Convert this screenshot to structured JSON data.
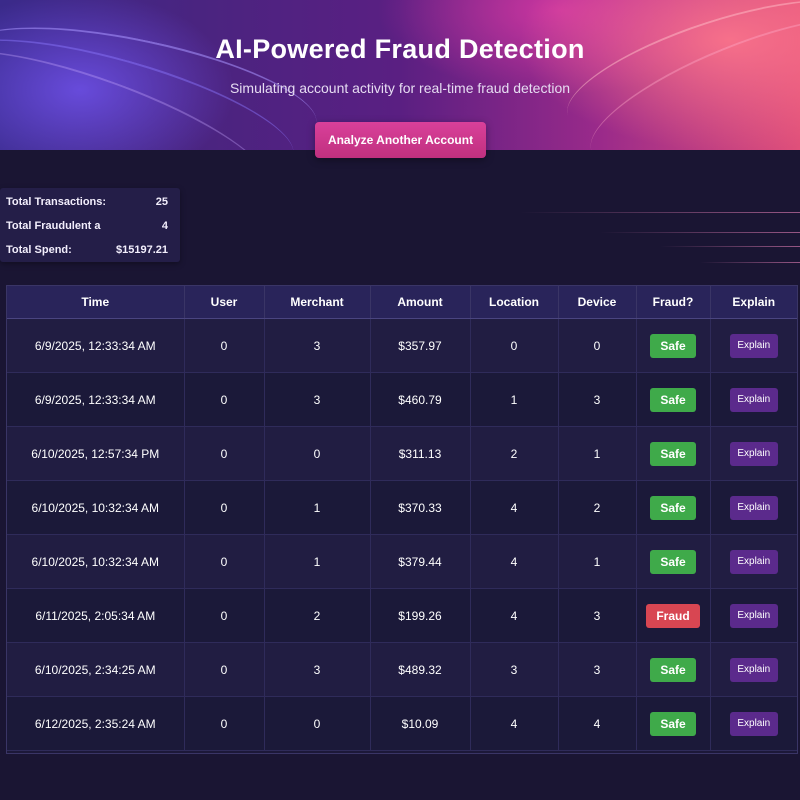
{
  "header": {
    "title": "AI-Powered Fraud Detection",
    "subtitle": "Simulating account activity for real-time fraud detection",
    "analyze_button_label": "Analyze Another Account"
  },
  "summary": {
    "items": [
      {
        "label": "Total Transactions:",
        "value": "25"
      },
      {
        "label": "Total Fraudulent a",
        "value": "4"
      },
      {
        "label": "Total Spend:",
        "value": "$15197.21"
      }
    ]
  },
  "table": {
    "columns": [
      "Time",
      "User",
      "Merchant",
      "Amount",
      "Location",
      "Device",
      "Fraud?",
      "Explain"
    ],
    "rows": [
      {
        "time": "6/9/2025, 12:33:34 AM",
        "user": "0",
        "merchant": "3",
        "amount": "$357.97",
        "location": "0",
        "device": "0",
        "fraud": "Safe",
        "explain": "Explain"
      },
      {
        "time": "6/9/2025, 12:33:34 AM",
        "user": "0",
        "merchant": "3",
        "amount": "$460.79",
        "location": "1",
        "device": "3",
        "fraud": "Safe",
        "explain": "Explain"
      },
      {
        "time": "6/10/2025, 12:57:34 PM",
        "user": "0",
        "merchant": "0",
        "amount": "$311.13",
        "location": "2",
        "device": "1",
        "fraud": "Safe",
        "explain": "Explain"
      },
      {
        "time": "6/10/2025, 10:32:34 AM",
        "user": "0",
        "merchant": "1",
        "amount": "$370.33",
        "location": "4",
        "device": "2",
        "fraud": "Safe",
        "explain": "Explain"
      },
      {
        "time": "6/10/2025, 10:32:34 AM",
        "user": "0",
        "merchant": "1",
        "amount": "$379.44",
        "location": "4",
        "device": "1",
        "fraud": "Safe",
        "explain": "Explain"
      },
      {
        "time": "6/11/2025, 2:05:34 AM",
        "user": "0",
        "merchant": "2",
        "amount": "$199.26",
        "location": "4",
        "device": "3",
        "fraud": "Fraud",
        "explain": "Explain"
      },
      {
        "time": "6/10/2025, 2:34:25 AM",
        "user": "0",
        "merchant": "3",
        "amount": "$489.32",
        "location": "3",
        "device": "3",
        "fraud": "Safe",
        "explain": "Explain"
      },
      {
        "time": "6/12/2025, 2:35:24 AM",
        "user": "0",
        "merchant": "0",
        "amount": "$10.09",
        "location": "4",
        "device": "4",
        "fraud": "Safe",
        "explain": "Explain"
      }
    ]
  },
  "colors": {
    "safe": "#3faa4a",
    "fraud": "#d84652",
    "explain_button": "#5b2a8c",
    "accent_button": "#d9409a"
  }
}
